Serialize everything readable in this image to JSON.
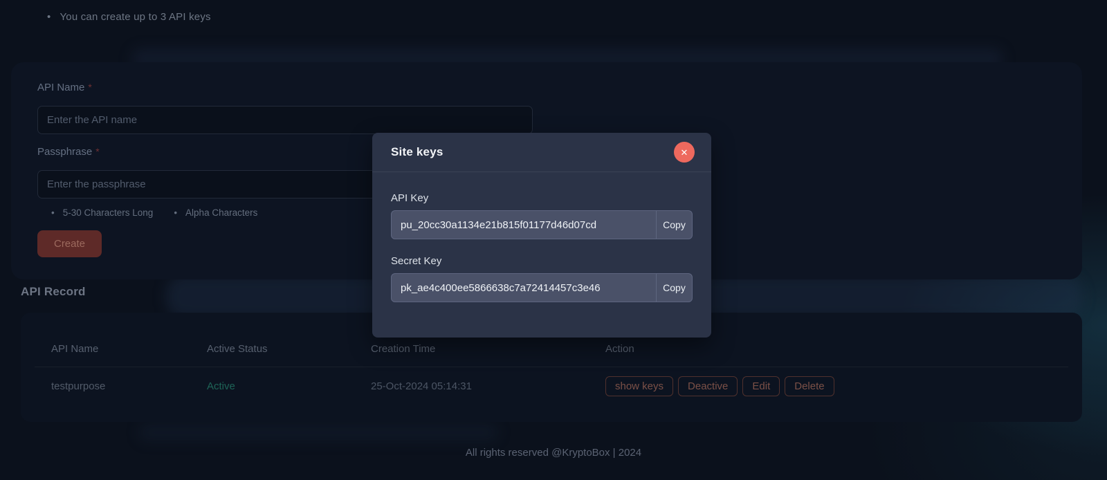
{
  "page": {
    "note": "You can create up to 3 API keys",
    "footer": "All rights reserved @KryptoBox | 2024"
  },
  "form": {
    "api_name_label": "API Name",
    "required_mark": "*",
    "api_name_placeholder": "Enter the API name",
    "passphrase_label": "Passphrase",
    "passphrase_placeholder": "Enter the passphrase",
    "hints": [
      "5-30 Characters Long",
      "Alpha Characters"
    ],
    "create_label": "Create"
  },
  "record": {
    "title": "API Record",
    "columns": [
      "API Name",
      "Active Status",
      "Creation Time",
      "Action"
    ],
    "rows": [
      {
        "api_name": "testpurpose",
        "status": "Active",
        "creation_time": "25-Oct-2024 05:14:31",
        "actions": [
          "show keys",
          "Deactive",
          "Edit",
          "Delete"
        ]
      }
    ]
  },
  "modal": {
    "title": "Site keys",
    "close_icon": "✕",
    "api_key_label": "API Key",
    "api_key_value": "pu_20cc30a1134e21b815f01177d46d07cd",
    "secret_key_label": "Secret Key",
    "secret_key_value": "pk_ae4c400ee5866638c7a72414457c3e46",
    "copy_label": "Copy"
  },
  "colors": {
    "modal_bg": "#2b3347",
    "close_red": "#ee695e",
    "active_teal": "#1e6457",
    "accent_maroon": "#5e2a28"
  }
}
